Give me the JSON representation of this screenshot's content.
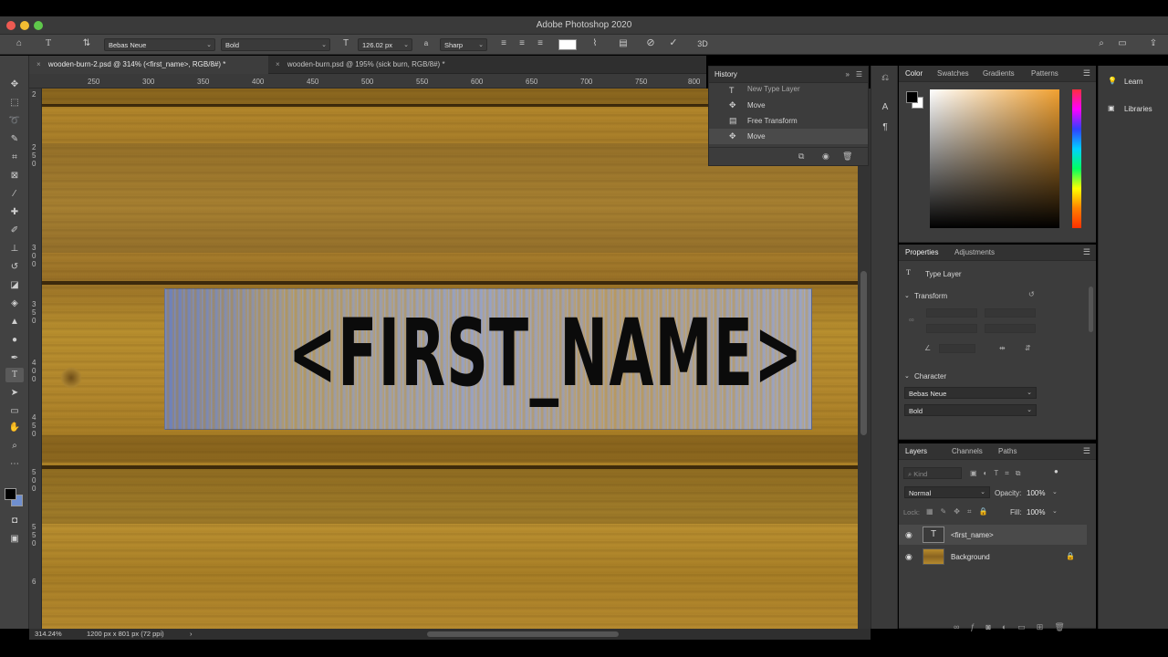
{
  "app": {
    "title": "Adobe Photoshop 2020"
  },
  "options_bar": {
    "font_family": "Bebas Neue",
    "font_style": "Bold",
    "font_size": "126.02 px",
    "aa_icon_label": "a",
    "anti_alias": "Sharp",
    "threed_label": "3D",
    "icons": [
      "home-icon",
      "type-tool-icon",
      "text-orientation-icon",
      "font-size-icon",
      "anti-alias-icon",
      "align-left-icon",
      "align-center-icon",
      "align-right-icon",
      "color-swatch",
      "warp-text-icon",
      "character-panel-icon",
      "cancel-icon",
      "commit-icon",
      "3d-icon",
      "search-icon",
      "workspace-icon",
      "share-icon"
    ]
  },
  "tabs": [
    {
      "label": "wooden-burn-2.psd @ 314% (<first_name>, RGB/8#) *",
      "active": true
    },
    {
      "label": "wooden-burn.psd @ 195% (sick burn, RGB/8#) *",
      "active": false
    }
  ],
  "ruler": {
    "h_ticks": [
      "250",
      "300",
      "350",
      "400",
      "450",
      "500",
      "550",
      "600",
      "650",
      "700",
      "750",
      "800"
    ],
    "v_ticks": [
      "2",
      "2\n5\n0",
      "3\n0\n0",
      "3\n5\n0",
      "4\n0\n0",
      "4\n5\n0",
      "5\n0\n0",
      "5\n5\n0",
      "6"
    ]
  },
  "canvas": {
    "text_layer_content": "<FIRST_NAME>",
    "colors": {
      "wood": "#b88b2c",
      "text": "#0b0b0b",
      "grain_blue": "#4461b8"
    }
  },
  "status": {
    "zoom": "314.24%",
    "doc_info": "1200 px x 801 px (72 ppi)",
    "arrow": "›"
  },
  "history": {
    "title": "History",
    "items": [
      {
        "label": "New Type Layer",
        "icon": "type-layer-icon"
      },
      {
        "label": "Move",
        "icon": "move-icon"
      },
      {
        "label": "Free Transform",
        "icon": "transform-icon"
      },
      {
        "label": "Move",
        "icon": "move-icon",
        "selected": true
      }
    ]
  },
  "color_panel": {
    "tabs": [
      "Color",
      "Swatches",
      "Gradients",
      "Patterns"
    ],
    "foreground": "#000000",
    "background": "#ffffff"
  },
  "properties": {
    "tabs": [
      "Properties",
      "Adjustments"
    ],
    "type_label": "Type Layer",
    "transform_label": "Transform",
    "character_label": "Character",
    "font_family": "Bebas Neue",
    "font_style": "Bold"
  },
  "layers": {
    "tabs": [
      "Layers",
      "Channels",
      "Paths"
    ],
    "kind_placeholder": "Kind",
    "blend_mode": "Normal",
    "opacity_label": "Opacity:",
    "opacity": "100%",
    "lock_label": "Lock:",
    "fill_label": "Fill:",
    "fill": "100%",
    "items": [
      {
        "name": "<first_name>",
        "type": "text",
        "selected": true
      },
      {
        "name": "Background",
        "type": "image",
        "locked": true
      }
    ]
  },
  "right_strip": {
    "learn": "Learn",
    "libraries": "Libraries"
  }
}
